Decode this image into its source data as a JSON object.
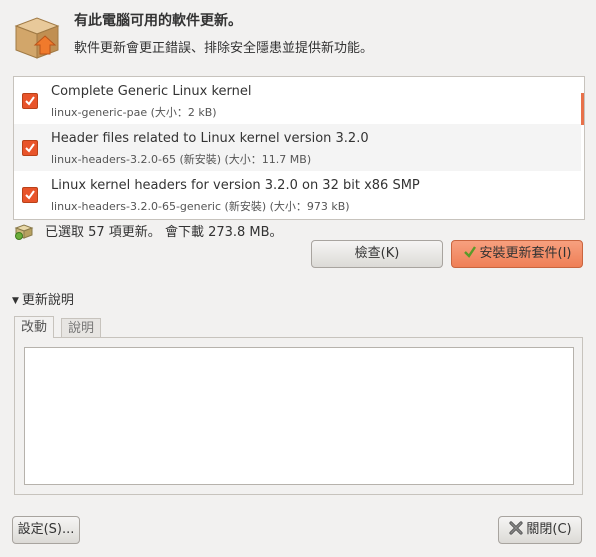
{
  "header": {
    "icon": "package-box-icon",
    "title": "有此電腦可用的軟件更新。",
    "subtitle": "軟件更新會更正錯誤、排除安全隱患並提供新功能。"
  },
  "updates": [
    {
      "checked": true,
      "name": "Complete Generic Linux kernel",
      "package": "linux-generic-pae (大小：2 kB)"
    },
    {
      "checked": true,
      "name": "Header files related to Linux kernel version 3.2.0",
      "package": "linux-headers-3.2.0-65 (新安裝) (大小：11.7 MB)"
    },
    {
      "checked": true,
      "name": "Linux kernel headers for version 3.2.0 on 32 bit x86 SMP",
      "package": "linux-headers-3.2.0-65-generic (新安裝) (大小：973 kB)"
    }
  ],
  "status": {
    "icon": "download-package-icon",
    "text": "已選取 57 項更新。 會下載 273.8 MB。"
  },
  "buttons": {
    "check": "檢查(K)",
    "install": "安裝更新套件(I)",
    "settings": "設定(S)...",
    "close": "關閉(C)"
  },
  "details": {
    "toggle_label": "更新說明",
    "tabs": [
      "改動",
      "說明"
    ],
    "active_tab": "改動"
  },
  "colors": {
    "accent": "#ef7f56",
    "checkbox": "#e8542a",
    "window_bg": "#f2f1f0"
  }
}
